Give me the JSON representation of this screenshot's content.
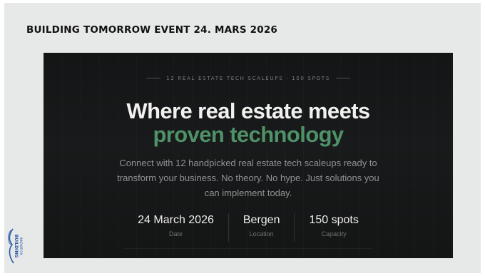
{
  "slide": {
    "title": "BUILDING TOMORROW EVENT 24. MARS 2026"
  },
  "hero": {
    "eyebrow": "12 REAL ESTATE TECH SCALEUPS · 150 SPOTS",
    "headline_line1": "Where real estate meets",
    "headline_line2": "proven technology",
    "description": "Connect with 12 handpicked real estate tech scaleups ready to transform your business. No theory. No hype. Just solutions you can implement today.",
    "stats": [
      {
        "value": "24 March 2026",
        "label": "Date"
      },
      {
        "value": "Bergen",
        "label": "Location"
      },
      {
        "value": "150 spots",
        "label": "Capacity"
      }
    ]
  },
  "logo": {
    "line1": "BUILDING",
    "line2": "INNOVATION"
  },
  "colors": {
    "accent_green": "#4f9268",
    "hero_background": "#161718",
    "slide_background": "#e6e9e7",
    "logo_blue": "#2a5aa8"
  }
}
